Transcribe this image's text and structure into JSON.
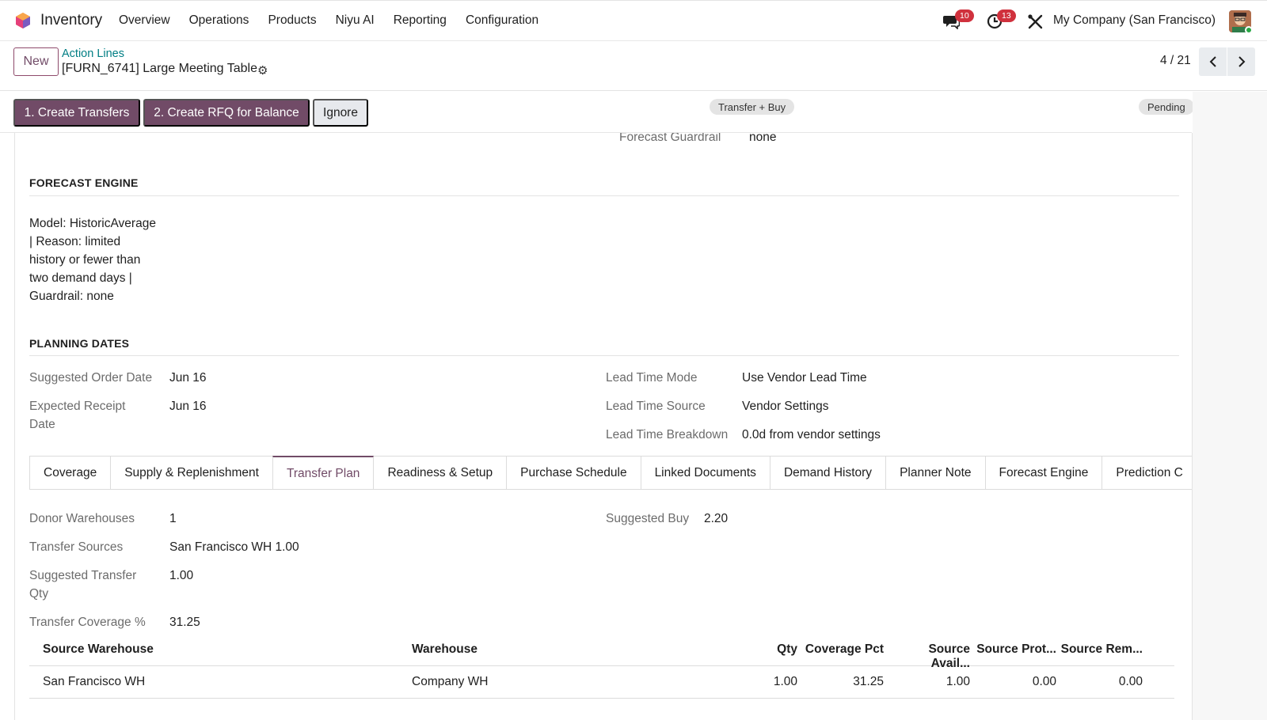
{
  "nav": {
    "app_name": "Inventory",
    "menu": [
      "Overview",
      "Operations",
      "Products",
      "Niyu AI",
      "Reporting",
      "Configuration"
    ],
    "messages_count": "10",
    "activities_count": "13",
    "company": "My Company (San Francisco)"
  },
  "control": {
    "new_label": "New",
    "breadcrumb_parent": "Action Lines",
    "record_title": "[FURN_6741] Large Meeting Table",
    "pager": "4 / 21"
  },
  "statusbar": {
    "btn_create_transfers": "1. Create Transfers",
    "btn_create_rfq": "2. Create RFQ for Balance",
    "btn_ignore": "Ignore",
    "type_pill": "Transfer + Buy",
    "state_pill": "Pending"
  },
  "top_partial": {
    "label": "Forecast Guardrail",
    "value": "none"
  },
  "forecast_engine": {
    "title": "FORECAST ENGINE",
    "lines": [
      "Model: HistoricAverage",
      "| Reason: limited",
      "history or fewer than",
      "two demand days |",
      "Guardrail: none"
    ]
  },
  "planning_dates": {
    "title": "PLANNING DATES",
    "suggested_order_label": "Suggested Order Date",
    "suggested_order_value": "Jun 16",
    "expected_receipt_label_1": "Expected Receipt",
    "expected_receipt_label_2": "Date",
    "expected_receipt_value": "Jun 16",
    "lead_time_mode_label": "Lead Time Mode",
    "lead_time_mode_value": "Use Vendor Lead Time",
    "lead_time_source_label": "Lead Time Source",
    "lead_time_source_value": "Vendor Settings",
    "lead_time_breakdown_label": "Lead Time Breakdown",
    "lead_time_breakdown_value": "0.0d from vendor settings"
  },
  "tabs": [
    "Coverage",
    "Supply & Replenishment",
    "Transfer Plan",
    "Readiness & Setup",
    "Purchase Schedule",
    "Linked Documents",
    "Demand History",
    "Planner Note",
    "Forecast Engine",
    "Prediction C"
  ],
  "active_tab": "Transfer Plan",
  "transfer_plan": {
    "donor_label": "Donor Warehouses",
    "donor_value": "1",
    "sources_label": "Transfer Sources",
    "sources_value": "San Francisco WH 1.00",
    "qty_label_1": "Suggested Transfer",
    "qty_label_2": "Qty",
    "qty_value": "1.00",
    "coverage_label": "Transfer Coverage %",
    "coverage_value": "31.25",
    "buy_label": "Suggested Buy",
    "buy_value": "2.20"
  },
  "table": {
    "headers": [
      "Source Warehouse",
      "Warehouse",
      "Qty",
      "Coverage Pct",
      "Source Avail...",
      "Source Prot...",
      "Source Rem..."
    ],
    "rows": [
      [
        "San Francisco WH",
        "Company WH",
        "1.00",
        "31.25",
        "1.00",
        "0.00",
        "0.00"
      ]
    ]
  },
  "colors": {
    "brand": "#714b67",
    "link": "#017e84",
    "badge": "#d0313d"
  }
}
